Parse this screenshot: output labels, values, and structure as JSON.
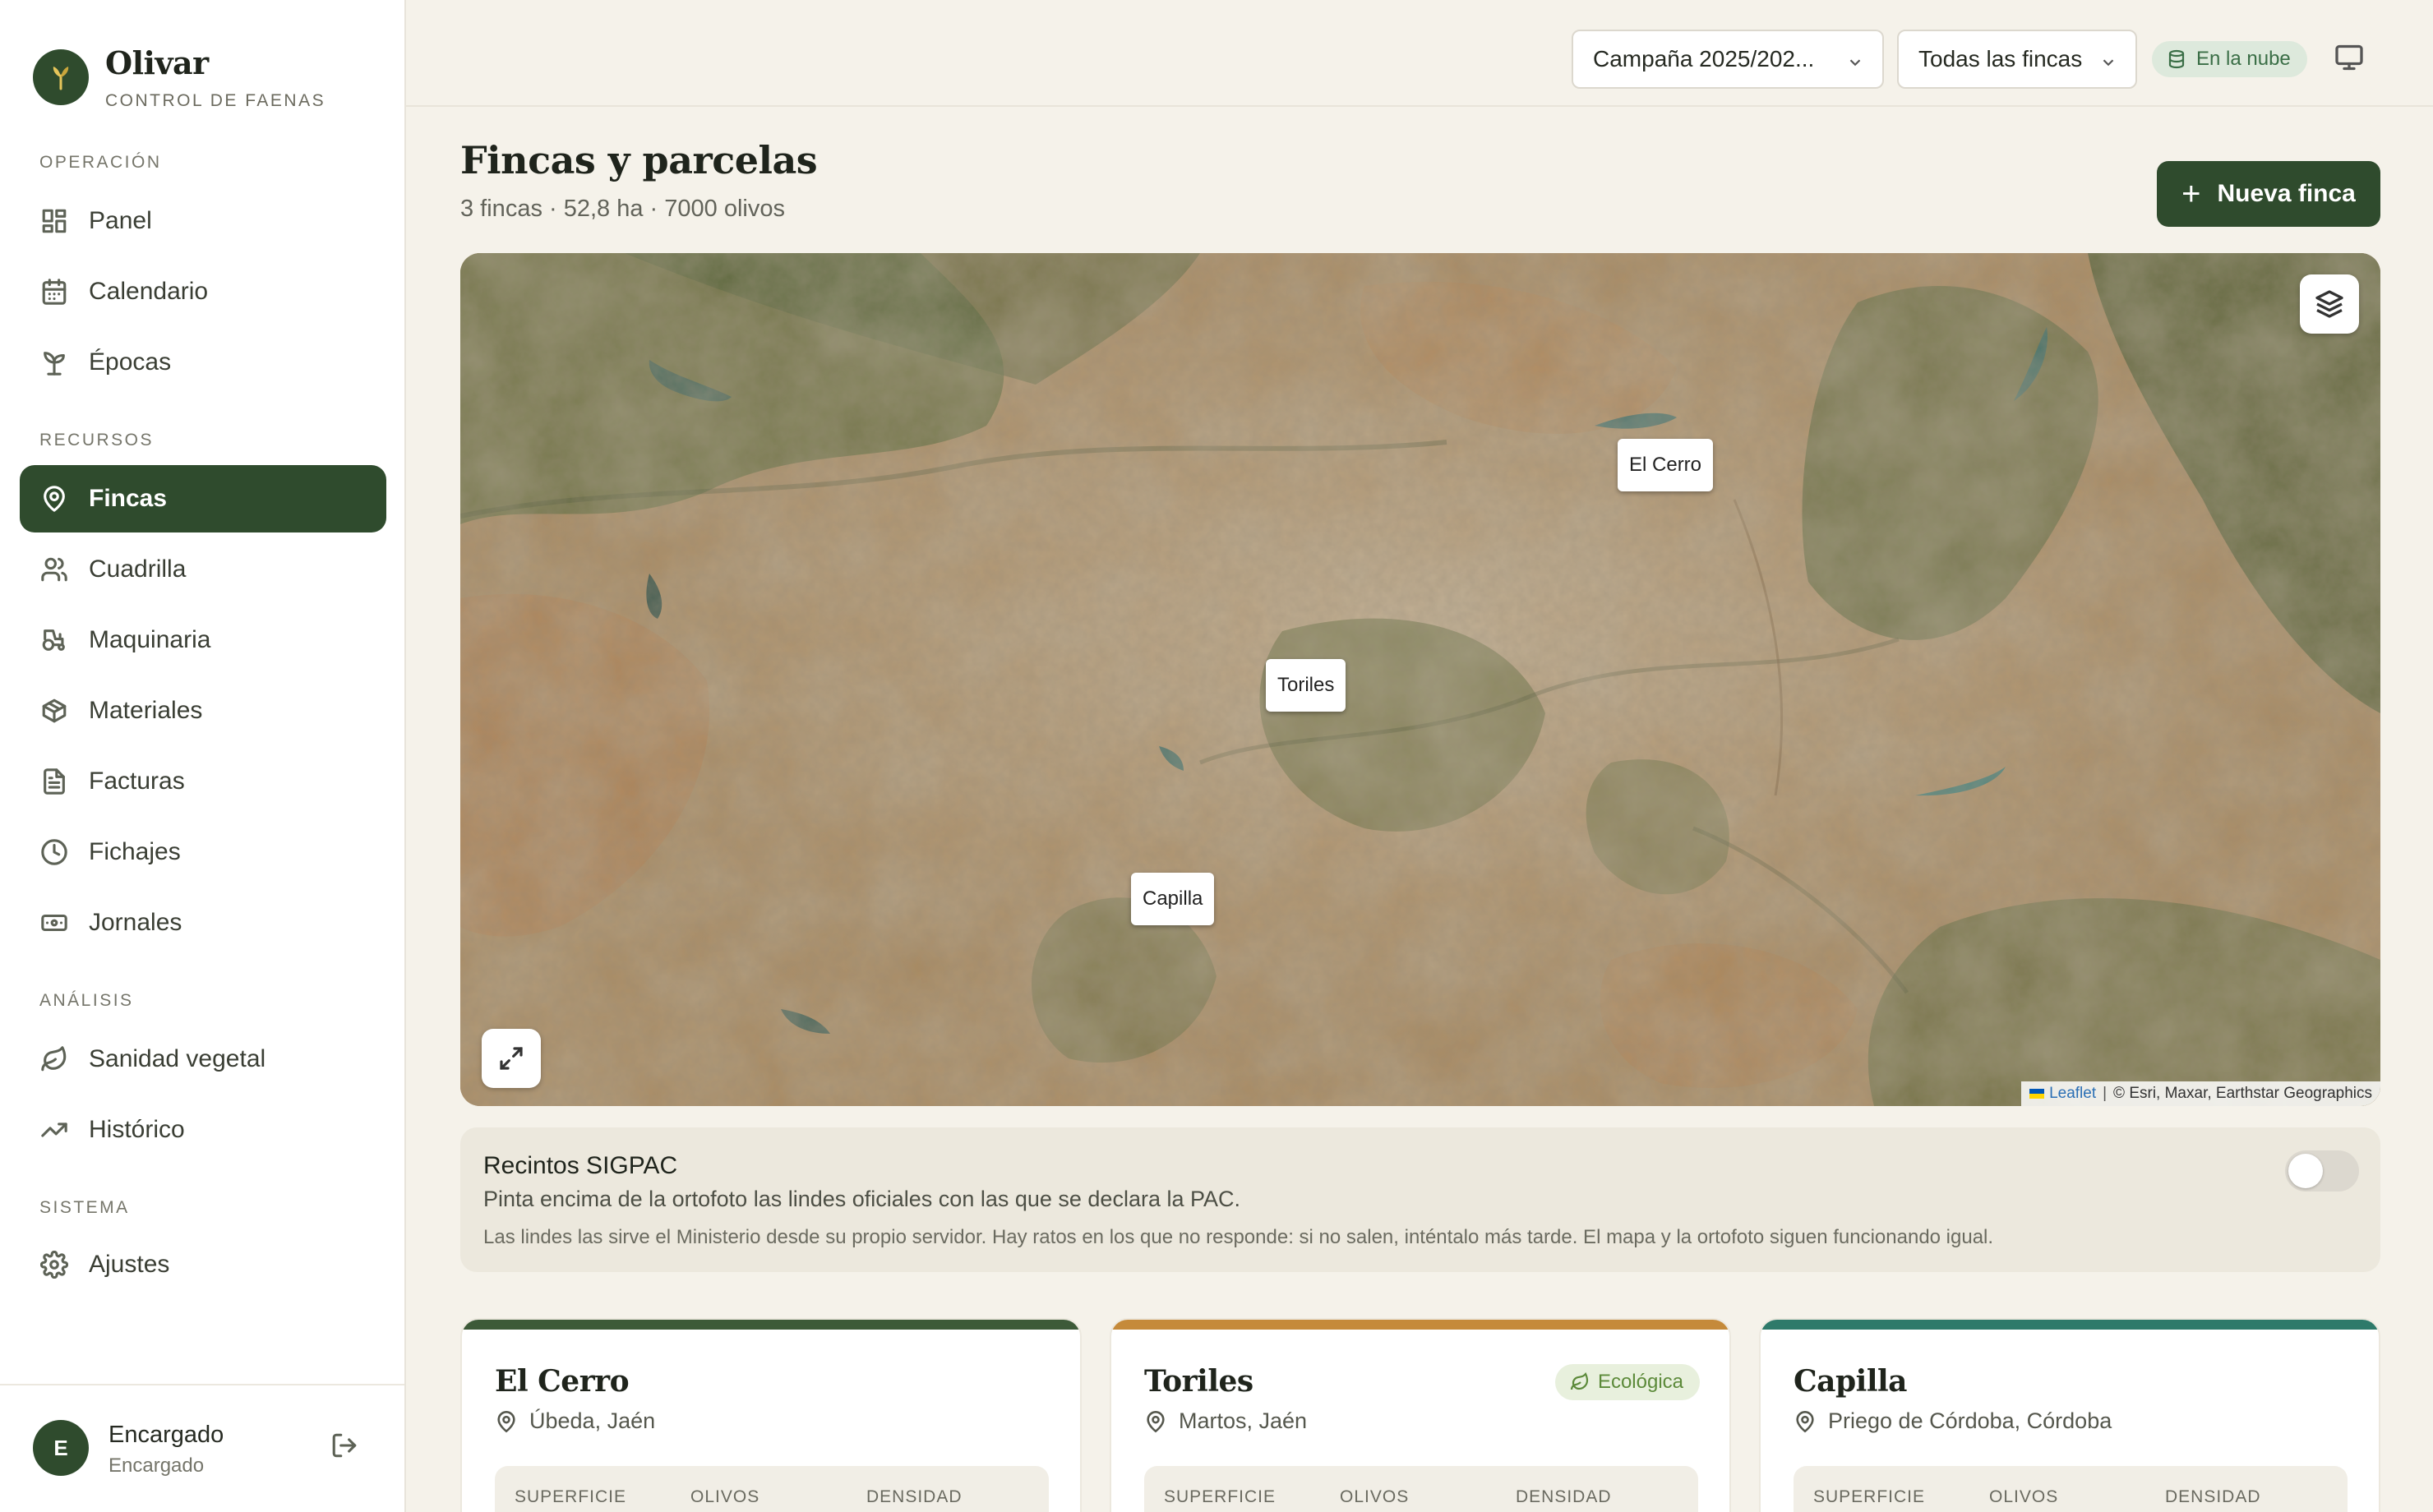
{
  "brand": {
    "name": "Olivar",
    "subtitle": "CONTROL DE FAENAS"
  },
  "sidebar": {
    "sections": [
      {
        "label": "OPERACIÓN"
      },
      {
        "label": "RECURSOS"
      },
      {
        "label": "ANÁLISIS"
      },
      {
        "label": "SISTEMA"
      }
    ],
    "items": [
      {
        "label": "Panel",
        "icon": "grid-icon"
      },
      {
        "label": "Calendario",
        "icon": "calendar-icon"
      },
      {
        "label": "Épocas",
        "icon": "sprout-icon"
      },
      {
        "label": "Fincas",
        "icon": "map-pin-icon",
        "active": true
      },
      {
        "label": "Cuadrilla",
        "icon": "users-icon"
      },
      {
        "label": "Maquinaria",
        "icon": "tractor-icon"
      },
      {
        "label": "Materiales",
        "icon": "package-icon"
      },
      {
        "label": "Facturas",
        "icon": "file-text-icon"
      },
      {
        "label": "Fichajes",
        "icon": "clock-icon"
      },
      {
        "label": "Jornales",
        "icon": "banknote-icon"
      },
      {
        "label": "Sanidad vegetal",
        "icon": "leaf-icon"
      },
      {
        "label": "Histórico",
        "icon": "trending-up-icon"
      },
      {
        "label": "Ajustes",
        "icon": "gear-icon"
      }
    ],
    "user": {
      "initial": "E",
      "name": "Encargado",
      "role": "Encargado"
    }
  },
  "topbar": {
    "campaign_select": "Campaña 2025/202...",
    "farm_select": "Todas las fincas",
    "cloud_status": "En la nube"
  },
  "page": {
    "title": "Fincas y parcelas",
    "subtitle": "3 fincas · 52,8 ha · 7000 olivos",
    "new_button": "Nueva finca"
  },
  "map": {
    "labels": [
      {
        "name": "El Cerro"
      },
      {
        "name": "Toriles"
      },
      {
        "name": "Capilla"
      }
    ],
    "attribution_link": "Leaflet",
    "attribution_text": "© Esri, Maxar, Earthstar Geographics"
  },
  "sigpac": {
    "title": "Recintos SIGPAC",
    "description": "Pinta encima de la ortofoto las lindes oficiales con las que se declara la PAC.",
    "note": "Las lindes las sirve el Ministerio desde su propio servidor. Hay ratos en los que no responde: si no salen, inténtalo más tarde. El mapa y la ortofoto siguen funcionando igual.",
    "enabled": false
  },
  "farms": [
    {
      "name": "El Cerro",
      "location": "Úbeda, Jaén",
      "color": "#3d5a38",
      "badge": ""
    },
    {
      "name": "Toriles",
      "location": "Martos, Jaén",
      "color": "#c58a3a",
      "badge": "Ecológica"
    },
    {
      "name": "Capilla",
      "location": "Priego de Córdoba, Córdoba",
      "color": "#2e7a6a",
      "badge": ""
    }
  ],
  "stat_headers": {
    "area": "SUPERFICIE",
    "trees": "OLIVOS",
    "density": "DENSIDAD"
  },
  "colors": {
    "accent": "#2f4b2d",
    "background": "#f5f2ea",
    "cloud_badge": "#3a6e46"
  }
}
